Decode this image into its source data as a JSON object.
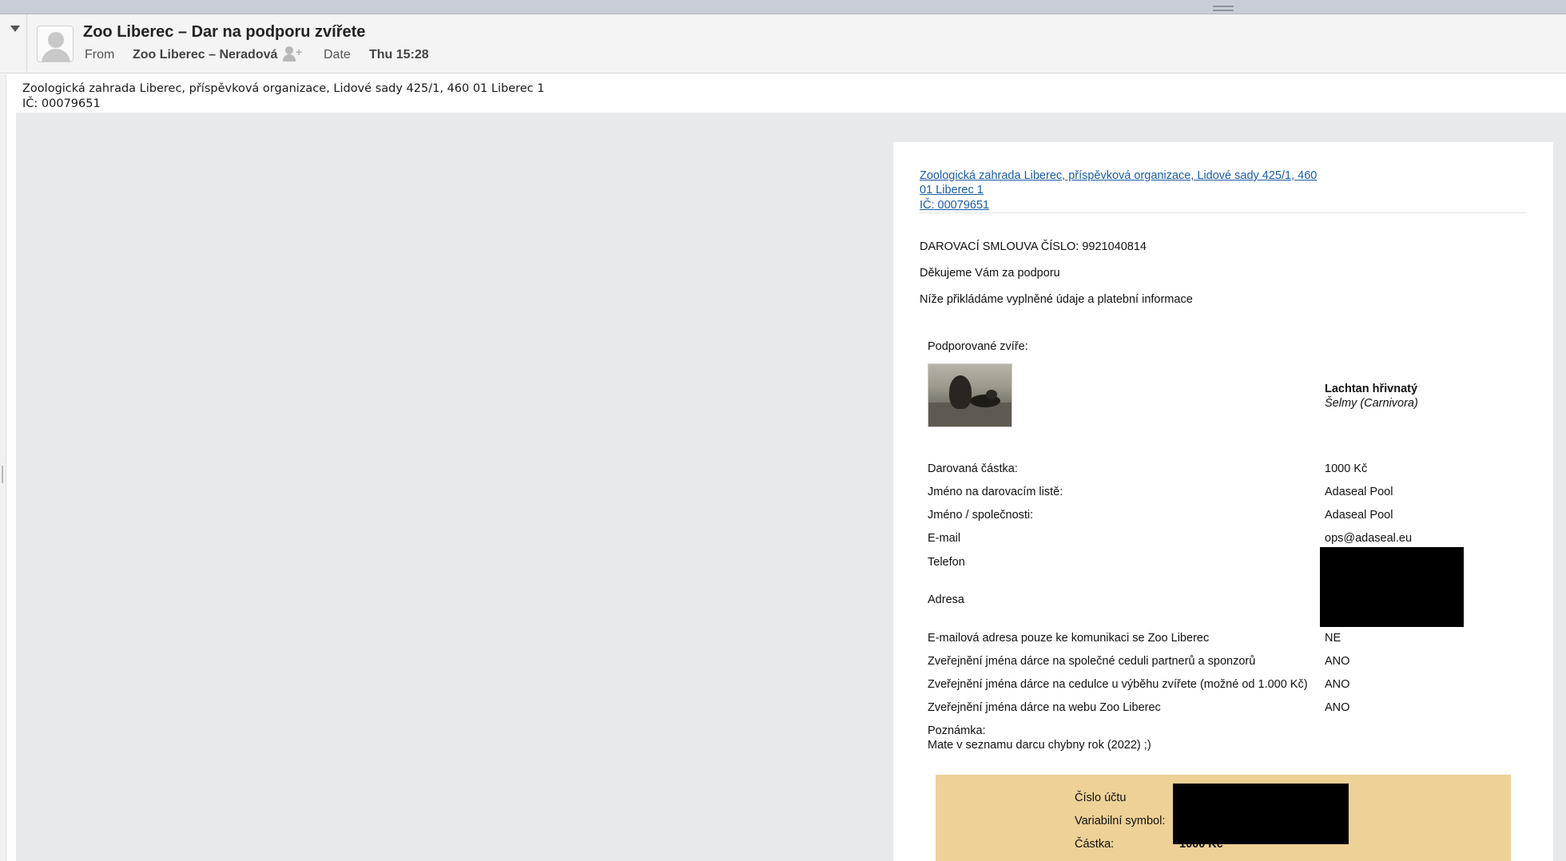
{
  "header": {
    "subject": "Zoo Liberec – Dar na podporu zvířete",
    "from_label": "From",
    "from_value": "Zoo Liberec – Neradová",
    "date_label": "Date",
    "date_value": "Thu 15:28",
    "add_contact_glyph": "+"
  },
  "plain_header": {
    "line1": "Zoologická zahrada Liberec, příspěvková organizace, Lidové sady 425/1, 460 01 Liberec 1",
    "line2": "IČ: 00079651"
  },
  "letter": {
    "link_line1": "Zoologická zahrada Liberec, příspěvková organizace, Lidové sady 425/1, 460",
    "link_line2": "01 Liberec 1",
    "link_line3": "IČ: 00079651",
    "contract": "DAROVACÍ SMLOUVA ČÍSLO: 9921040814",
    "thanks": "Děkujeme Vám za podporu",
    "intro": "Níže přikládáme vyplněné údaje a platební informace",
    "animal_label": "Podporované zvíře:",
    "animal_name": "Lachtan hřivnatý",
    "animal_order": "Šelmy (Carnivora)",
    "fields": [
      {
        "label": "Darovaná částka:",
        "value": "1000 Kč"
      },
      {
        "label": "Jméno na darovacím listě:",
        "value": "Adaseal Pool"
      },
      {
        "label": "Jméno / společnosti:",
        "value": "Adaseal Pool"
      },
      {
        "label": "E-mail",
        "value": "ops@adaseal.eu"
      },
      {
        "label": "Telefon",
        "value": ""
      },
      {
        "label": "Adresa",
        "value": ""
      },
      {
        "label": "E-mailová adresa pouze ke komunikaci se Zoo Liberec",
        "value": "NE"
      },
      {
        "label": "Zveřejnění jména dárce na společné ceduli partnerů a sponzorů",
        "value": "ANO"
      },
      {
        "label": "Zveřejnění jména dárce na cedulce u výběhu zvířete (možné od 1.000 Kč)",
        "value": "ANO"
      },
      {
        "label": "Zveřejnění jména dárce na webu Zoo Liberec",
        "value": "ANO"
      }
    ],
    "note_label": "Poznámka:",
    "note_text": "Mate v seznamu darcu chybny rok (2022) ;)"
  },
  "payment": {
    "account_label": "Číslo účtu",
    "vs_label": "Variabilní symbol:",
    "amount_label": "Částka:",
    "amount_value": "1000 Kč",
    "background": "#edd196"
  },
  "colors": {
    "link": "#1a5dab",
    "panel_bg": "#e8e9eb",
    "redaction": "#000000"
  }
}
